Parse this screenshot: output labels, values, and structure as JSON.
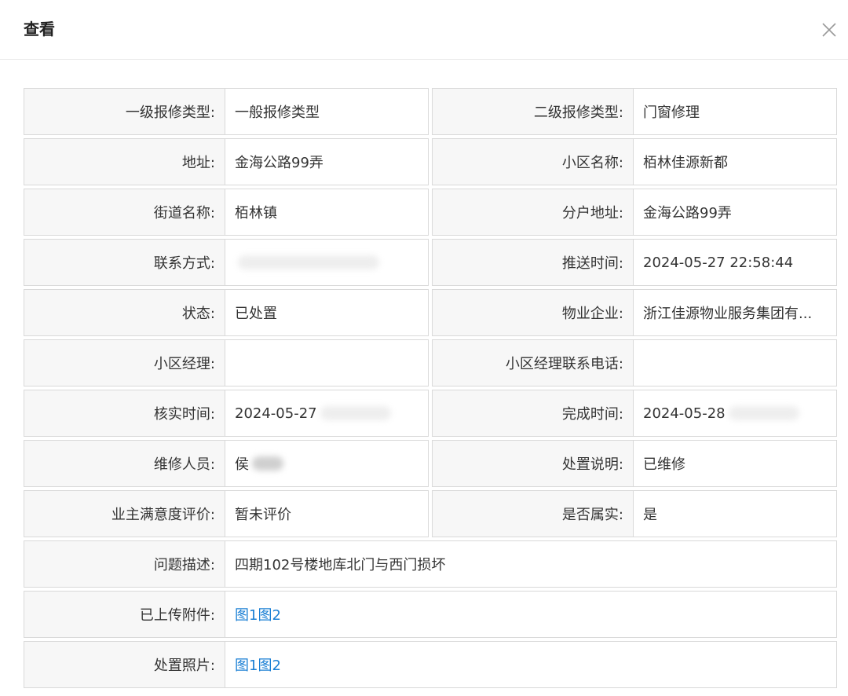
{
  "dialog": {
    "title": "查看"
  },
  "icons": {
    "close": "close-icon"
  },
  "rows": [
    [
      {
        "label": "一级报修类型:",
        "value": "一般报修类型"
      },
      {
        "label": "二级报修类型:",
        "value": "门窗修理"
      }
    ],
    [
      {
        "label": "地址:",
        "value": "金海公路99弄"
      },
      {
        "label": "小区名称:",
        "value": "栢林佳源新都"
      }
    ],
    [
      {
        "label": "街道名称:",
        "value": "栢林镇"
      },
      {
        "label": "分户地址:",
        "value": "金海公路99弄"
      }
    ],
    [
      {
        "label": "联系方式:",
        "value": ""
      },
      {
        "label": "推送时间:",
        "value": "2024-05-27 22:58:44"
      }
    ],
    [
      {
        "label": "状态:",
        "value": "已处置"
      },
      {
        "label": "物业企业:",
        "value": "浙江佳源物业服务集团有..."
      }
    ],
    [
      {
        "label": "小区经理:",
        "value": ""
      },
      {
        "label": "小区经理联系电话:",
        "value": ""
      }
    ],
    [
      {
        "label": "核实时间:",
        "value": "2024-05-27"
      },
      {
        "label": "完成时间:",
        "value": "2024-05-28"
      }
    ],
    [
      {
        "label": "维修人员:",
        "value": "侯"
      },
      {
        "label": "处置说明:",
        "value": "已维修"
      }
    ],
    [
      {
        "label": "业主满意度评价:",
        "value": "暂未评价"
      },
      {
        "label": "是否属实:",
        "value": "是"
      }
    ]
  ],
  "problem": {
    "label": "问题描述:",
    "value": "四期102号楼地库北门与西门损坏"
  },
  "attachments": {
    "label": "已上传附件:",
    "links": [
      "图1",
      "图2"
    ]
  },
  "photos": {
    "label": "处置照片:",
    "links": [
      "图1",
      "图2"
    ]
  },
  "colors": {
    "link": "#1a7fd4",
    "label_bg": "#f7f7f7",
    "border": "#d9d9d9"
  }
}
